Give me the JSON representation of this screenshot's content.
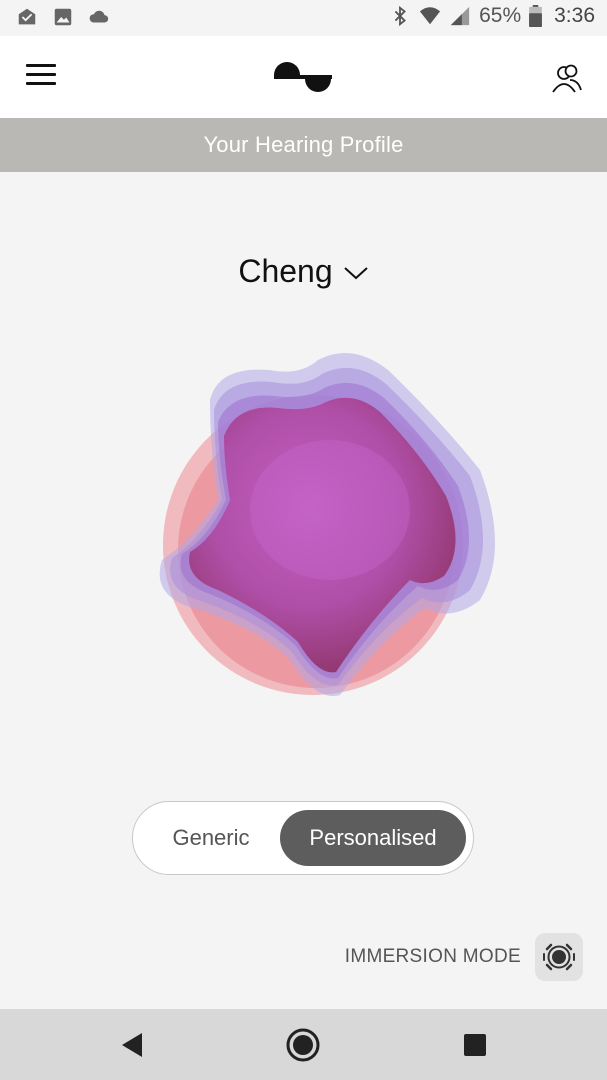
{
  "status_bar": {
    "battery_percent": "65%",
    "time": "3:36",
    "left_icons": [
      "inbox-check-icon",
      "image-icon",
      "cloud-icon"
    ],
    "right_icons": [
      "bluetooth-icon",
      "wifi-icon",
      "cellular-signal-icon",
      "battery-icon"
    ]
  },
  "app_bar": {
    "icons": [
      "hamburger-menu-icon",
      "brand-logo",
      "profiles-icon"
    ]
  },
  "header": {
    "title": "Your Hearing Profile"
  },
  "profile": {
    "user_name": "Cheng",
    "dropdown_icon": "chevron-down-icon"
  },
  "mode_toggle": {
    "options": [
      "Generic",
      "Personalised"
    ],
    "selected": "Personalised"
  },
  "immersion": {
    "label": "IMMERSION MODE",
    "icon": "immersion-icon"
  },
  "nav_bar": {
    "icons": [
      "back-icon",
      "home-icon",
      "recents-icon"
    ]
  },
  "colors": {
    "title_strip": "#b9b8b4",
    "toggle_selected": "#5d5d5d",
    "blob_pink": "#e2667a",
    "blob_purple": "#b457b8",
    "blob_lavender": "#a99be0"
  }
}
